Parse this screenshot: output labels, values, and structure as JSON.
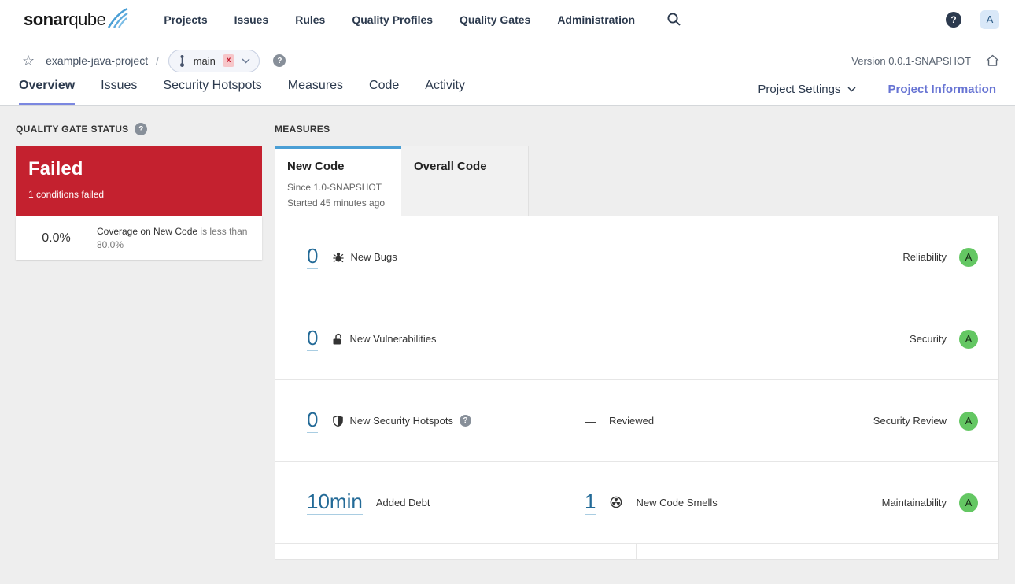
{
  "nav": {
    "logo": {
      "bold": "sonar",
      "light": "qube"
    },
    "items": [
      "Projects",
      "Issues",
      "Rules",
      "Quality Profiles",
      "Quality Gates",
      "Administration"
    ],
    "help": "?",
    "avatar": "A"
  },
  "breadcrumb": {
    "project": "example-java-project",
    "separator": "/",
    "branch": {
      "name": "main",
      "badge": "x"
    },
    "help": "?",
    "version": "Version 0.0.1-SNAPSHOT"
  },
  "tabs": {
    "items": [
      "Overview",
      "Issues",
      "Security Hotspots",
      "Measures",
      "Code",
      "Activity"
    ],
    "active": "Overview",
    "project_settings": "Project Settings",
    "project_information": "Project Information"
  },
  "quality_gate": {
    "title": "QUALITY GATE STATUS",
    "help": "?",
    "status": "Failed",
    "conditions_summary": "1 conditions failed",
    "condition": {
      "value": "0.0%",
      "metric": "Coverage on New Code",
      "comparison": " is less than 80.0%"
    }
  },
  "measures": {
    "title": "MEASURES",
    "tabs": {
      "new_code": {
        "label": "New Code",
        "line1": "Since 1.0-SNAPSHOT",
        "line2": "Started 45 minutes ago"
      },
      "overall_code": {
        "label": "Overall Code"
      }
    },
    "rows": {
      "bugs": {
        "value": "0",
        "label": "New Bugs",
        "domain": "Reliability",
        "rating": "A"
      },
      "vulnerabilities": {
        "value": "0",
        "label": "New Vulnerabilities",
        "domain": "Security",
        "rating": "A"
      },
      "hotspots": {
        "value": "0",
        "label": "New Security Hotspots",
        "help": "?",
        "dash": "—",
        "reviewed": "Reviewed",
        "domain": "Security Review",
        "rating": "A"
      },
      "maintainability": {
        "debt_value": "10min",
        "debt_label": "Added Debt",
        "smells_value": "1",
        "smells_label": "New Code Smells",
        "domain": "Maintainability",
        "rating": "A"
      }
    }
  },
  "colors": {
    "failed_red": "#c4212f",
    "measure_link_blue": "#236a97",
    "active_tab_accent": "#4b9fd5",
    "rating_a_green": "#64c763",
    "indigo_link": "#6673d3"
  }
}
